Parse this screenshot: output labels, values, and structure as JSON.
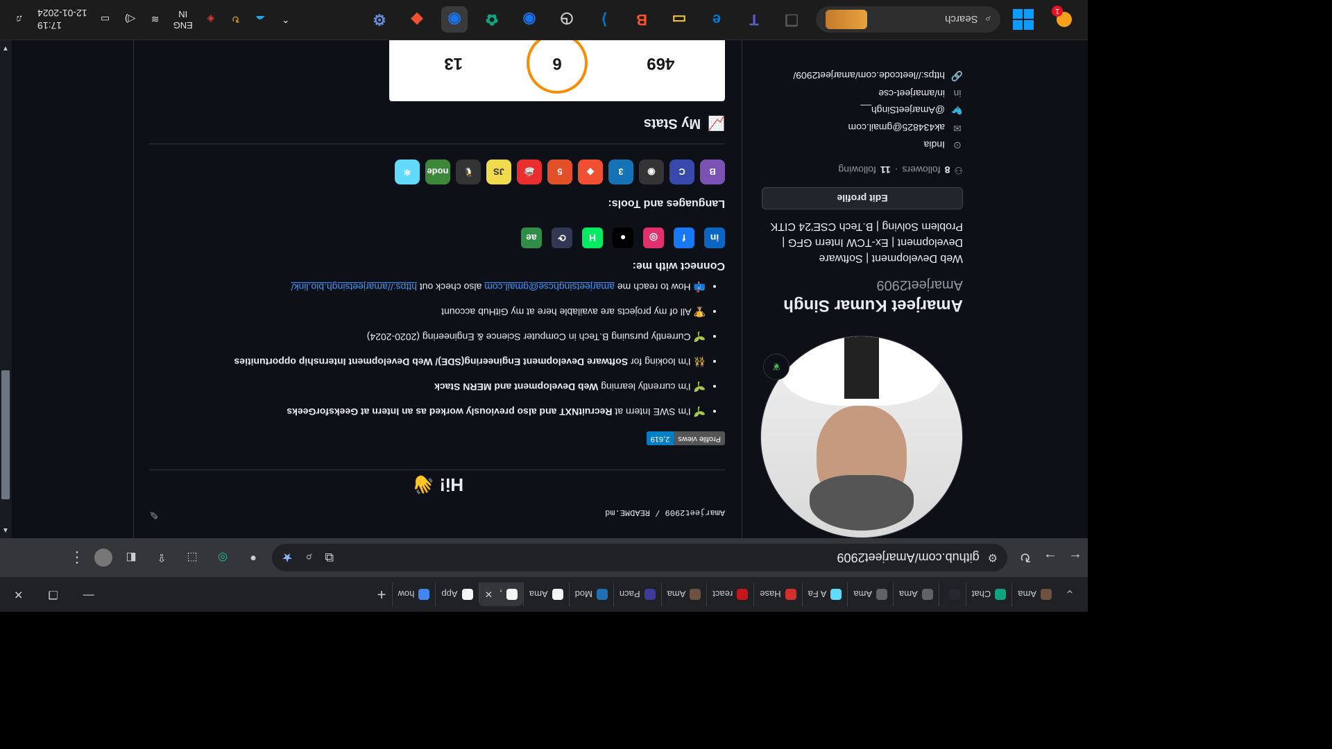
{
  "tabs": [
    {
      "label": "Ama",
      "color": "#6e5040"
    },
    {
      "label": "Chat",
      "color": "#10a37f"
    },
    {
      "label": "",
      "color": "#24292f"
    },
    {
      "label": "Ama",
      "color": "#5f6368"
    },
    {
      "label": "Ama",
      "color": "#5f6368"
    },
    {
      "label": "A Fa",
      "color": "#61dafb"
    },
    {
      "label": "Hase",
      "color": "#d32f2f"
    },
    {
      "label": "react",
      "color": "#c4161c"
    },
    {
      "label": "Ama",
      "color": "#6e5040"
    },
    {
      "label": "Pacn",
      "color": "#3b3b9a"
    },
    {
      "label": "Mod",
      "color": "#1f6fb2"
    },
    {
      "label": "Ama",
      "color": "#f5f5f5"
    },
    {
      "label": ",",
      "color": "#f5f5f5"
    },
    {
      "label": "App",
      "color": "#f5f5f5"
    },
    {
      "label": "how",
      "color": "#4285f4"
    }
  ],
  "browser": {
    "url": "github.com/Amarjeet2909"
  },
  "profile": {
    "fullname": "Amarjeet Kumar Singh",
    "username": "Amarjeet2909",
    "bio": "Web Development | Software Development | Ex-TCW Intern GFG | Problem Solving | B.Tech CSE'24 CITK",
    "edit_label": "Edit profile",
    "followers": "8",
    "followers_label": "followers",
    "following": "11",
    "following_label": "following",
    "location": "India",
    "email": "ak434825@gmail.com",
    "twitter": "@AmarjeetSingh__",
    "linkedin": "in/amarjeet-cse",
    "website": "https://leetcode.com/amarjeet2909/"
  },
  "readme": {
    "path": "Amarjeet2909 / README.md",
    "greeting": "Hi!",
    "views_label": "Profile views",
    "views_value": "2,619",
    "line1_pre": "I'm SWE Intern at ",
    "line1_bold": "RecruitNXT",
    "line1_mid": " and also previously worked as an Intern at ",
    "line1_bold2": "GeeksforGeeks",
    "line2_pre": "I'm currently learning ",
    "line2_bold": "Web Development",
    "line2_mid": " and ",
    "line2_bold2": "MERN Stack",
    "line3_pre": "I'm looking for ",
    "line3_bold": "Software Development Engineering(SDE)/ Web Development Internship opportunities",
    "line4": "Currently pursuing B.Tech in Computer Science & Engineering (2020-2024)",
    "line5": "All of my projects are available here at my GitHub account",
    "line6_pre": "How to reach me ",
    "line6_email": "amarjeetsinghcse@gmail.com",
    "line6_mid": " also check out ",
    "line6_link": "https://amarjeetsingh.bio.link/",
    "connect_title": "Connect with me:",
    "tools_title": "Languages and Tools:",
    "stats_title": "My Stats",
    "stat_total": "469",
    "stat_streak": "6",
    "stat_longest": "13"
  },
  "social_icons": [
    {
      "name": "linkedin-icon",
      "glyph": "in",
      "color": "#0a66c2"
    },
    {
      "name": "facebook-icon",
      "glyph": "f",
      "color": "#1877f2"
    },
    {
      "name": "instagram-icon",
      "glyph": "◎",
      "color": "#e1306c"
    },
    {
      "name": "github-icon",
      "glyph": "●",
      "color": "#000000"
    },
    {
      "name": "hackerrank-icon",
      "glyph": "H",
      "color": "#00ea64"
    },
    {
      "name": "hackerearth-icon",
      "glyph": "⟳",
      "color": "#323754"
    },
    {
      "name": "geeksforgeeks-icon",
      "glyph": "ae",
      "color": "#2f8d46"
    }
  ],
  "tool_icons": [
    {
      "name": "bootstrap-icon",
      "glyph": "B",
      "color": "#7952b3"
    },
    {
      "name": "c-icon",
      "glyph": "C",
      "color": "#3949ab"
    },
    {
      "name": "circleci-icon",
      "glyph": "◉",
      "color": "#343434"
    },
    {
      "name": "css3-icon",
      "glyph": "3",
      "color": "#1572b6"
    },
    {
      "name": "git-icon",
      "glyph": "◆",
      "color": "#f05032"
    },
    {
      "name": "html5-icon",
      "glyph": "5",
      "color": "#e34f26"
    },
    {
      "name": "java-icon",
      "glyph": "☕",
      "color": "#ea2d2e"
    },
    {
      "name": "javascript-icon",
      "glyph": "JS",
      "color": "#f0db4f"
    },
    {
      "name": "linux-icon",
      "glyph": "🐧",
      "color": "#333333"
    },
    {
      "name": "nodejs-icon",
      "glyph": "node",
      "color": "#3c873a"
    },
    {
      "name": "react-icon",
      "glyph": "⚛",
      "color": "#61dafb"
    }
  ],
  "taskbar": {
    "search_placeholder": "Search",
    "weather_badge": "1",
    "lang_top": "ENG",
    "lang_bottom": "IN",
    "time": "17:19",
    "date": "12-01-2024"
  },
  "taskbar_apps": [
    {
      "name": "task-view-app",
      "glyph": "❐",
      "color": "#555555"
    },
    {
      "name": "teams-app",
      "glyph": "T",
      "color": "#5b5fc7"
    },
    {
      "name": "edge-app",
      "glyph": "e",
      "color": "#0078d7"
    },
    {
      "name": "file-explorer-app",
      "glyph": "▭",
      "color": "#f8c537"
    },
    {
      "name": "brave-app",
      "glyph": "B",
      "color": "#fb542b"
    },
    {
      "name": "vscode-app",
      "glyph": "⟩",
      "color": "#007acc"
    },
    {
      "name": "clock-app",
      "glyph": "◷",
      "color": "#cccccc"
    },
    {
      "name": "chrome-app",
      "glyph": "◉",
      "color": "#1a73e8"
    },
    {
      "name": "chatgpt-app",
      "glyph": "✿",
      "color": "#10a37f"
    },
    {
      "name": "chrome-profile-app",
      "glyph": "◉",
      "color": "#1a73e8"
    },
    {
      "name": "git-app",
      "glyph": "◆",
      "color": "#f05032"
    },
    {
      "name": "settings-app",
      "glyph": "⚙",
      "color": "#6b8bd6"
    }
  ]
}
